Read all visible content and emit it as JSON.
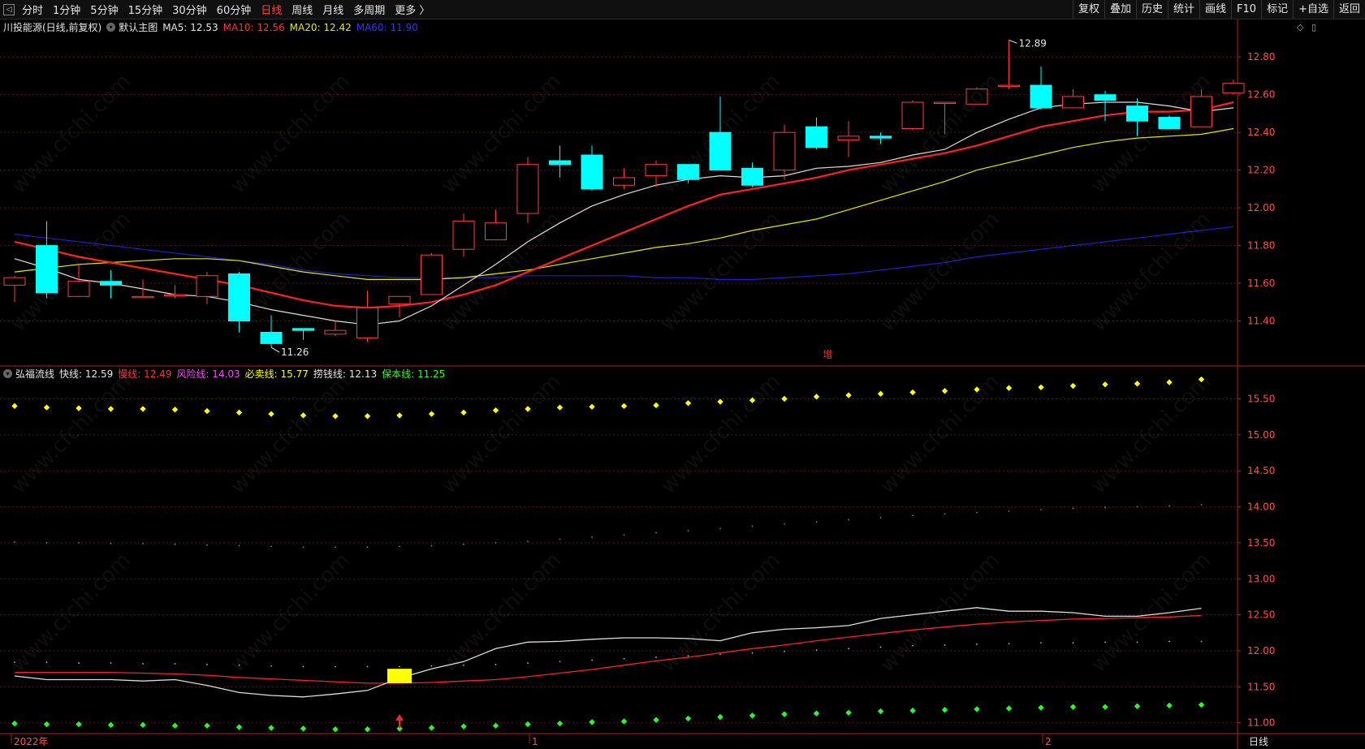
{
  "toolbar": {
    "periods": [
      {
        "label": "分时",
        "active": false
      },
      {
        "label": "1分钟",
        "active": false
      },
      {
        "label": "5分钟",
        "active": false
      },
      {
        "label": "15分钟",
        "active": false
      },
      {
        "label": "30分钟",
        "active": false
      },
      {
        "label": "60分钟",
        "active": false
      },
      {
        "label": "日线",
        "active": true
      },
      {
        "label": "周线",
        "active": false
      },
      {
        "label": "月线",
        "active": false
      },
      {
        "label": "多周期",
        "active": false
      },
      {
        "label": "更多 〉",
        "active": false
      }
    ],
    "right_buttons": [
      "复权",
      "叠加",
      "历史",
      "统计",
      "画线",
      "F10",
      "标记",
      "+自选",
      "返回"
    ]
  },
  "main_legend": {
    "stock": "川投能源(日线,前复权)",
    "chart_name": "默认主图",
    "ma5": "MA5: 12.53",
    "ma10": "MA10: 12.56",
    "ma20": "MA20: 12.42",
    "ma60": "MA60: 11.90"
  },
  "indicator_legend": {
    "name": "弘福流线",
    "fast": "快线: 12.59",
    "slow": "慢线: 12.49",
    "risk": "风险线: 14.03",
    "sell": "必卖线: 15.77",
    "profit": "捞钱线: 12.13",
    "cost": "保本线: 11.25"
  },
  "annotations": {
    "high": "12.89",
    "low": "11.26",
    "signal_text": "增"
  },
  "bottom_axis": {
    "labels": [
      "2022年",
      "1",
      "2"
    ],
    "right_label": "日线"
  },
  "watermark": "www.cfchi.com",
  "colors": {
    "up": "#ff3b3b",
    "down": "#00ffff",
    "ma5": "#dddddd",
    "ma10": "#ff2020",
    "ma20": "#e6e600",
    "ma60": "#1e1ecc",
    "risk": "#ff44ff",
    "sell": "#ffff00",
    "cost": "#22ff22"
  },
  "chart_data": [
    {
      "type": "candlestick",
      "title": "川投能源(日线,前复权)",
      "y_axis_ticks": [
        "12.80",
        "12.60",
        "12.40",
        "12.20",
        "12.00",
        "11.80",
        "11.60",
        "11.40"
      ],
      "ylim": [
        11.2,
        12.93
      ],
      "candles": [
        {
          "o": 11.59,
          "h": 11.64,
          "l": 11.5,
          "c": 11.63
        },
        {
          "o": 11.8,
          "h": 11.93,
          "l": 11.52,
          "c": 11.55
        },
        {
          "o": 11.53,
          "h": 11.7,
          "l": 11.53,
          "c": 11.61
        },
        {
          "o": 11.61,
          "h": 11.67,
          "l": 11.52,
          "c": 11.59
        },
        {
          "o": 11.53,
          "h": 11.62,
          "l": 11.53,
          "c": 11.53
        },
        {
          "o": 11.54,
          "h": 11.59,
          "l": 11.52,
          "c": 11.54
        },
        {
          "o": 11.53,
          "h": 11.66,
          "l": 11.49,
          "c": 11.64
        },
        {
          "o": 11.65,
          "h": 11.66,
          "l": 11.34,
          "c": 11.4
        },
        {
          "o": 11.34,
          "h": 11.43,
          "l": 11.26,
          "c": 11.28
        },
        {
          "o": 11.36,
          "h": 11.36,
          "l": 11.3,
          "c": 11.35
        },
        {
          "o": 11.33,
          "h": 11.4,
          "l": 11.32,
          "c": 11.35
        },
        {
          "o": 11.31,
          "h": 11.56,
          "l": 11.29,
          "c": 11.47
        },
        {
          "o": 11.49,
          "h": 11.53,
          "l": 11.42,
          "c": 11.53
        },
        {
          "o": 11.54,
          "h": 11.76,
          "l": 11.54,
          "c": 11.75
        },
        {
          "o": 11.78,
          "h": 11.97,
          "l": 11.74,
          "c": 11.93
        },
        {
          "o": 11.83,
          "h": 11.99,
          "l": 11.83,
          "c": 11.92
        },
        {
          "o": 11.97,
          "h": 12.27,
          "l": 11.92,
          "c": 12.23
        },
        {
          "o": 12.25,
          "h": 12.33,
          "l": 12.16,
          "c": 12.23
        },
        {
          "o": 12.28,
          "h": 12.33,
          "l": 12.09,
          "c": 12.1
        },
        {
          "o": 12.12,
          "h": 12.21,
          "l": 12.1,
          "c": 12.16
        },
        {
          "o": 12.17,
          "h": 12.25,
          "l": 12.11,
          "c": 12.23
        },
        {
          "o": 12.23,
          "h": 12.23,
          "l": 12.13,
          "c": 12.15
        },
        {
          "o": 12.4,
          "h": 12.59,
          "l": 12.2,
          "c": 12.2
        },
        {
          "o": 12.21,
          "h": 12.24,
          "l": 12.11,
          "c": 12.12
        },
        {
          "o": 12.2,
          "h": 12.44,
          "l": 12.15,
          "c": 12.4
        },
        {
          "o": 12.43,
          "h": 12.48,
          "l": 12.31,
          "c": 12.32
        },
        {
          "o": 12.36,
          "h": 12.46,
          "l": 12.27,
          "c": 12.38
        },
        {
          "o": 12.38,
          "h": 12.4,
          "l": 12.34,
          "c": 12.37
        },
        {
          "o": 12.42,
          "h": 12.57,
          "l": 12.41,
          "c": 12.56
        },
        {
          "o": 12.56,
          "h": 12.56,
          "l": 12.39,
          "c": 12.56
        },
        {
          "o": 12.55,
          "h": 12.64,
          "l": 12.55,
          "c": 12.63
        },
        {
          "o": 12.65,
          "h": 12.89,
          "l": 12.63,
          "c": 12.65
        },
        {
          "o": 12.65,
          "h": 12.75,
          "l": 12.52,
          "c": 12.53
        },
        {
          "o": 12.53,
          "h": 12.63,
          "l": 12.53,
          "c": 12.59
        },
        {
          "o": 12.6,
          "h": 12.62,
          "l": 12.46,
          "c": 12.57
        },
        {
          "o": 12.54,
          "h": 12.58,
          "l": 12.38,
          "c": 12.46
        },
        {
          "o": 12.48,
          "h": 12.49,
          "l": 12.42,
          "c": 12.42
        },
        {
          "o": 12.43,
          "h": 12.63,
          "l": 12.43,
          "c": 12.59
        },
        {
          "o": 12.61,
          "h": 12.68,
          "l": 12.6,
          "c": 12.66
        }
      ],
      "ma5": [
        11.73,
        11.68,
        11.62,
        11.6,
        11.57,
        11.54,
        11.53,
        11.5,
        11.46,
        11.43,
        11.4,
        11.38,
        11.4,
        11.48,
        11.59,
        11.7,
        11.82,
        11.92,
        12.01,
        12.07,
        12.12,
        12.15,
        12.17,
        12.16,
        12.17,
        12.21,
        12.22,
        12.24,
        12.28,
        12.31,
        12.4,
        12.47,
        12.53,
        12.55,
        12.56,
        12.56,
        12.54,
        12.51,
        12.53
      ],
      "ma10": [
        11.82,
        11.78,
        11.74,
        11.71,
        11.68,
        11.65,
        11.62,
        11.59,
        11.55,
        11.51,
        11.48,
        11.47,
        11.48,
        11.5,
        11.54,
        11.59,
        11.66,
        11.73,
        11.8,
        11.87,
        11.94,
        12.01,
        12.07,
        12.1,
        12.13,
        12.16,
        12.2,
        12.23,
        12.26,
        12.29,
        12.33,
        12.38,
        12.43,
        12.46,
        12.49,
        12.51,
        12.51,
        12.52,
        12.56
      ],
      "ma20": [
        11.66,
        11.68,
        11.7,
        11.71,
        11.72,
        11.73,
        11.73,
        11.72,
        11.69,
        11.66,
        11.64,
        11.62,
        11.62,
        11.62,
        11.63,
        11.65,
        11.67,
        11.7,
        11.73,
        11.76,
        11.79,
        11.81,
        11.84,
        11.88,
        11.91,
        11.94,
        11.99,
        12.04,
        12.09,
        12.14,
        12.2,
        12.24,
        12.28,
        12.32,
        12.35,
        12.37,
        12.38,
        12.39,
        12.42
      ],
      "ma60": [
        11.86,
        11.84,
        11.82,
        11.8,
        11.78,
        11.76,
        11.74,
        11.72,
        11.7,
        11.67,
        11.65,
        11.64,
        11.63,
        11.63,
        11.63,
        11.63,
        11.64,
        11.64,
        11.64,
        11.64,
        11.63,
        11.63,
        11.62,
        11.62,
        11.63,
        11.64,
        11.65,
        11.67,
        11.69,
        11.71,
        11.74,
        11.76,
        11.78,
        11.8,
        11.82,
        11.84,
        11.86,
        11.88,
        11.9
      ]
    },
    {
      "type": "line",
      "title": "弘福流线",
      "y_axis_ticks": [
        "15.50",
        "15.00",
        "14.50",
        "14.00",
        "13.50",
        "13.00",
        "12.50",
        "12.00",
        "11.50",
        "11.00"
      ],
      "ylim": [
        10.85,
        15.9
      ],
      "fast": [
        11.65,
        11.6,
        11.6,
        11.6,
        11.58,
        11.6,
        11.52,
        11.42,
        11.38,
        11.36,
        11.4,
        11.45,
        11.62,
        11.75,
        11.85,
        12.03,
        12.12,
        12.13,
        12.16,
        12.18,
        12.18,
        12.17,
        12.14,
        12.25,
        12.3,
        12.32,
        12.35,
        12.45,
        12.5,
        12.55,
        12.6,
        12.55,
        12.55,
        12.53,
        12.48,
        12.48,
        12.53,
        12.59
      ],
      "slow": [
        11.7,
        11.7,
        11.7,
        11.7,
        11.69,
        11.68,
        11.66,
        11.63,
        11.61,
        11.59,
        11.57,
        11.55,
        11.55,
        11.56,
        11.58,
        11.6,
        11.64,
        11.69,
        11.74,
        11.8,
        11.86,
        11.91,
        11.97,
        12.03,
        12.08,
        12.14,
        12.19,
        12.24,
        12.29,
        12.33,
        12.37,
        12.4,
        12.42,
        12.44,
        12.45,
        12.46,
        12.47,
        12.49
      ],
      "sell": [
        15.4,
        15.38,
        15.37,
        15.36,
        15.36,
        15.35,
        15.33,
        15.31,
        15.29,
        15.27,
        15.26,
        15.26,
        15.27,
        15.29,
        15.31,
        15.34,
        15.36,
        15.38,
        15.39,
        15.4,
        15.41,
        15.44,
        15.46,
        15.48,
        15.5,
        15.53,
        15.55,
        15.57,
        15.59,
        15.61,
        15.63,
        15.65,
        15.66,
        15.68,
        15.7,
        15.71,
        15.73,
        15.77
      ],
      "risk": [
        13.51,
        13.5,
        13.5,
        13.49,
        13.49,
        13.48,
        13.47,
        13.46,
        13.45,
        13.44,
        13.44,
        13.44,
        13.45,
        13.46,
        13.48,
        13.5,
        13.52,
        13.55,
        13.58,
        13.61,
        13.64,
        13.67,
        13.7,
        13.73,
        13.76,
        13.79,
        13.82,
        13.85,
        13.88,
        13.9,
        13.92,
        13.94,
        13.96,
        13.98,
        13.99,
        14.0,
        14.01,
        14.03
      ],
      "profit": [
        11.84,
        11.84,
        11.83,
        11.83,
        11.82,
        11.82,
        11.81,
        11.8,
        11.79,
        11.78,
        11.78,
        11.78,
        11.78,
        11.79,
        11.8,
        11.81,
        11.83,
        11.85,
        11.87,
        11.89,
        11.91,
        11.93,
        11.95,
        11.97,
        11.99,
        12.01,
        12.03,
        12.05,
        12.07,
        12.08,
        12.09,
        12.1,
        12.11,
        12.11,
        12.12,
        12.12,
        12.13,
        12.13
      ],
      "cost": [
        10.99,
        10.98,
        10.98,
        10.97,
        10.97,
        10.96,
        10.96,
        10.94,
        10.93,
        10.92,
        10.91,
        10.91,
        10.92,
        10.93,
        10.95,
        10.96,
        10.98,
        10.99,
        11.01,
        11.02,
        11.04,
        11.06,
        11.08,
        11.1,
        11.12,
        11.13,
        11.14,
        11.16,
        11.17,
        11.18,
        11.19,
        11.2,
        11.21,
        11.22,
        11.22,
        11.23,
        11.24,
        11.25
      ],
      "signal_index": 12,
      "signal_bar": [
        11.55,
        11.75
      ]
    }
  ]
}
